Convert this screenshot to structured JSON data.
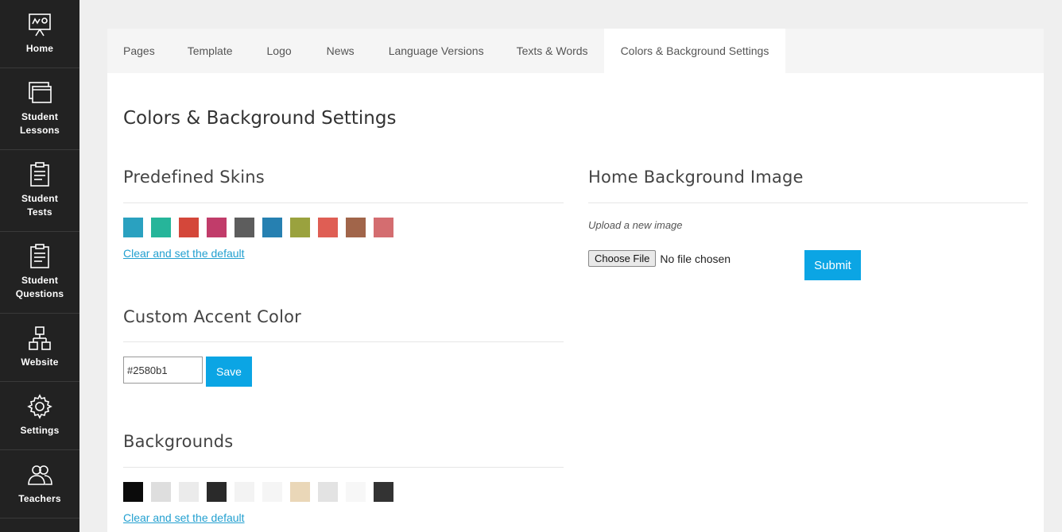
{
  "sidebar": {
    "items": [
      {
        "label": "Home",
        "icon": "presentation-board-icon"
      },
      {
        "label": "Student\nLessons",
        "icon": "windows-icon"
      },
      {
        "label": "Student\nTests",
        "icon": "clipboard-icon"
      },
      {
        "label": "Student\nQuestions",
        "icon": "clipboard-icon"
      },
      {
        "label": "Website",
        "icon": "sitemap-icon"
      },
      {
        "label": "Settings",
        "icon": "gear-icon"
      },
      {
        "label": "Teachers",
        "icon": "users-icon"
      }
    ]
  },
  "tabs": [
    {
      "label": "Pages"
    },
    {
      "label": "Template"
    },
    {
      "label": "Logo"
    },
    {
      "label": "News"
    },
    {
      "label": "Language Versions"
    },
    {
      "label": "Texts & Words"
    },
    {
      "label": "Colors & Background Settings",
      "active": true
    }
  ],
  "page_title": "Colors & Background Settings",
  "predefined_skins": {
    "title": "Predefined Skins",
    "colors": [
      "#2aa1c0",
      "#26b59a",
      "#d4473a",
      "#c13c6a",
      "#5d5d5d",
      "#2680b1",
      "#9aa23e",
      "#df5e54",
      "#a1654a",
      "#d46d70"
    ],
    "reset_link": "Clear and set the default"
  },
  "custom_accent": {
    "title": "Custom Accent Color",
    "value": "#2580b1",
    "save_label": "Save"
  },
  "backgrounds": {
    "title": "Backgrounds",
    "swatches": [
      "#0b0b0b",
      "#dedede",
      "#ebebeb",
      "#2a2a2a",
      "#f3f3f3",
      "#f5f5f5",
      "#ead7b8",
      "#e3e3e3",
      "#f7f7f7",
      "#333333"
    ],
    "reset_link": "Clear and set the default"
  },
  "home_background": {
    "title": "Home Background Image",
    "upload_label": "Upload a new image",
    "choose_file_label": "Choose File",
    "no_file_text": "No file chosen",
    "submit_label": "Submit"
  }
}
